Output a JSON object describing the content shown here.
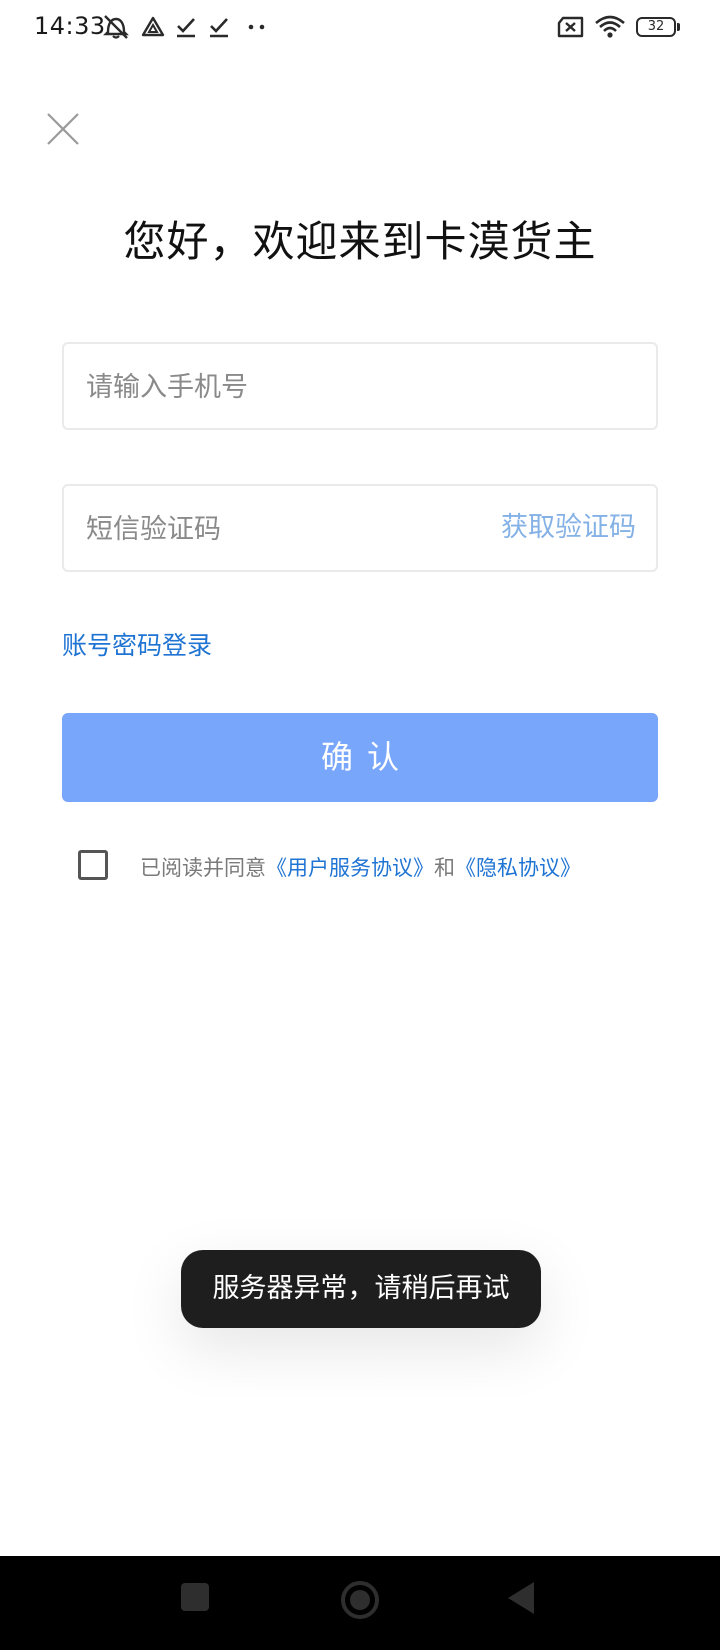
{
  "status_bar": {
    "time": "14:33",
    "battery": "32",
    "icons": [
      "mute-icon",
      "drive-icon",
      "check-icon",
      "check-icon",
      "more-dots-icon",
      "no-sim-icon",
      "wifi-icon",
      "battery-icon"
    ]
  },
  "header": {
    "close_icon": "close-icon",
    "title": "您好，欢迎来到卡漠货主"
  },
  "form": {
    "phone_placeholder": "请输入手机号",
    "phone_value": "",
    "code_placeholder": "短信验证码",
    "code_value": "",
    "get_code_label": "获取验证码",
    "password_login_label": "账号密码登录",
    "confirm_label": "确认"
  },
  "agreement": {
    "checked": false,
    "prefix": "已阅读并同意",
    "user_agreement": "《用户服务协议》",
    "conjunction": "和",
    "privacy_agreement": "《隐私协议》"
  },
  "toast": {
    "message": "服务器异常，请稍后再试"
  },
  "nav_bar": {
    "buttons": [
      "recents-icon",
      "home-icon",
      "back-icon"
    ]
  },
  "colors": {
    "accent": "#1f74d3",
    "button_disabled": "#78a6fb",
    "get_code": "#84b1e6",
    "toast_bg": "#1e1e1e",
    "nav_bg": "#000000"
  }
}
